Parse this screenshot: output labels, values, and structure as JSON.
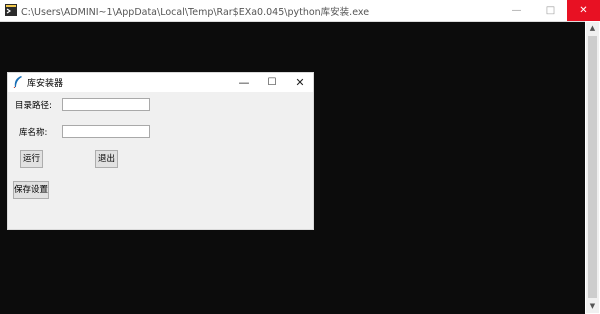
{
  "console": {
    "title": "C:\\Users\\ADMINI~1\\AppData\\Local\\Temp\\Rar$EXa0.045\\python库安装.exe",
    "controls": {
      "minimize": "—",
      "maximize": "□",
      "close": "✕"
    }
  },
  "app": {
    "title": "库安装器",
    "controls": {
      "minimize": "—",
      "maximize": "☐",
      "close": "✕"
    },
    "path_label": "目录路径:",
    "path_value": "",
    "name_label": "库名称:",
    "name_value": "",
    "run_button": "运行",
    "exit_button": "退出",
    "save_button": "保存设置"
  },
  "colors": {
    "console_bg": "#0c0c0c",
    "window_bg": "#f0f0f0",
    "close_hover": "#e81123"
  }
}
